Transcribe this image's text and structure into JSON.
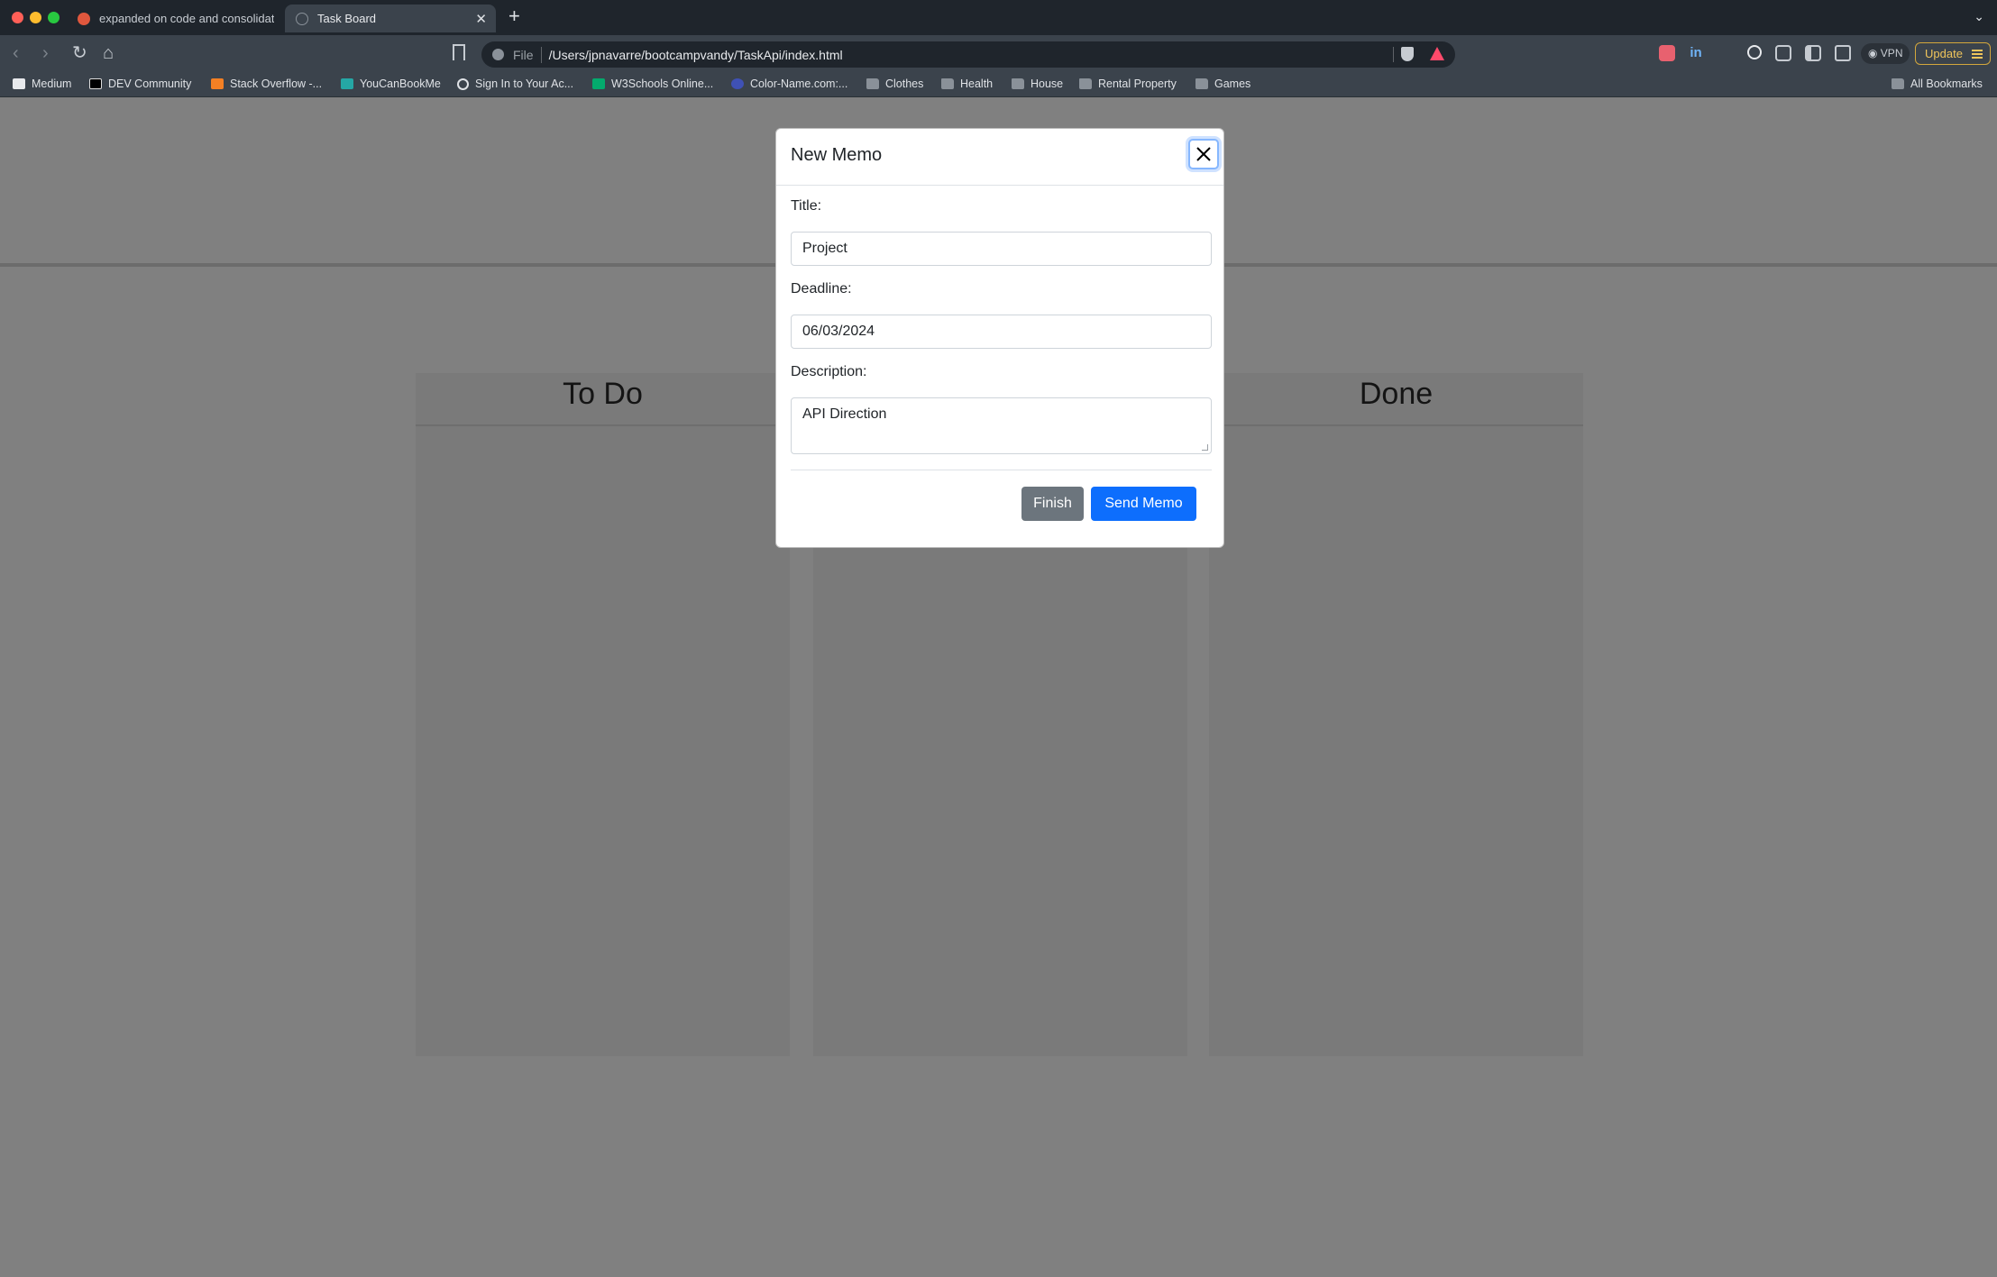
{
  "browser": {
    "tabs": [
      {
        "label": "expanded on code and consolidat",
        "active": false
      },
      {
        "label": "Task Board",
        "active": true
      }
    ],
    "new_tab_label": "+",
    "tab_close_label": "✕",
    "tab_menu_label": "⌄",
    "nav": {
      "back": "‹",
      "forward": "›",
      "reload": "↻",
      "home": "⌂"
    },
    "address": {
      "scheme": "File",
      "url": "/Users/jpnavarre/bootcampvandy/TaskApi/index.html"
    },
    "extensions": {
      "linkedin": "in"
    },
    "vpn_label": "◉ VPN",
    "update_label": "Update",
    "bookmarks": [
      {
        "label": "Medium",
        "icon": "medium-icon"
      },
      {
        "label": "DEV Community",
        "icon": "dev-icon"
      },
      {
        "label": "Stack Overflow -...",
        "icon": "stackoverflow-icon"
      },
      {
        "label": "YouCanBookMe",
        "icon": "youcanbookme-icon"
      },
      {
        "label": "Sign In to Your Ac...",
        "icon": "globe-icon"
      },
      {
        "label": "W3Schools Online...",
        "icon": "w3schools-icon"
      },
      {
        "label": "Color-Name.com:...",
        "icon": "colorname-icon"
      },
      {
        "label": "Clothes",
        "icon": "folder-icon"
      },
      {
        "label": "Health",
        "icon": "folder-icon"
      },
      {
        "label": "House",
        "icon": "folder-icon"
      },
      {
        "label": "Rental Property",
        "icon": "folder-icon"
      },
      {
        "label": "Games",
        "icon": "folder-icon"
      }
    ],
    "all_bookmarks_label": "All Bookmarks"
  },
  "board": {
    "lanes": [
      {
        "title": "To Do"
      },
      {
        "title": ""
      },
      {
        "title": "Done"
      }
    ]
  },
  "modal": {
    "title": "New Memo",
    "fields": {
      "title": {
        "label": "Title:",
        "value": "Project"
      },
      "deadline": {
        "label": "Deadline:",
        "value": "06/03/2024"
      },
      "description": {
        "label": "Description:",
        "value": "API Direction"
      }
    },
    "buttons": {
      "finish": "Finish",
      "send": "Send Memo"
    }
  },
  "colors": {
    "primary": "#0d6efd",
    "secondary": "#6c757d",
    "overlay": "#808080",
    "chrome_dark": "#1f252c",
    "chrome": "#3b434c"
  }
}
